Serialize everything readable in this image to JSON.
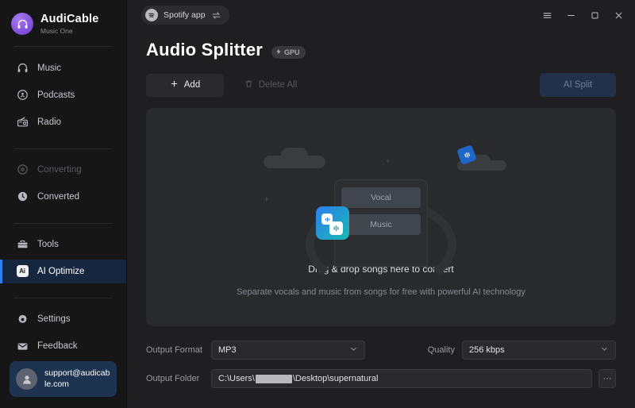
{
  "brand": {
    "name": "AudiCable",
    "subtitle": "Music One",
    "logo_icon": "headphones-icon"
  },
  "sidebar": {
    "groups": [
      {
        "items": [
          {
            "label": "Music",
            "icon": "headphones-icon",
            "state": "normal"
          },
          {
            "label": "Podcasts",
            "icon": "podcast-icon",
            "state": "normal"
          },
          {
            "label": "Radio",
            "icon": "radio-icon",
            "state": "normal"
          }
        ]
      },
      {
        "items": [
          {
            "label": "Converting",
            "icon": "sync-icon",
            "state": "disabled"
          },
          {
            "label": "Converted",
            "icon": "clock-icon",
            "state": "normal"
          }
        ]
      },
      {
        "items": [
          {
            "label": "Tools",
            "icon": "toolbox-icon",
            "state": "normal"
          },
          {
            "label": "AI Optimize",
            "icon": "ai-badge-icon",
            "state": "active"
          }
        ]
      },
      {
        "items": [
          {
            "label": "Settings",
            "icon": "gear-icon",
            "state": "normal"
          },
          {
            "label": "Feedback",
            "icon": "envelope-icon",
            "state": "normal"
          }
        ]
      }
    ],
    "user": {
      "email": "support@audicable.com",
      "avatar_icon": "user-avatar-icon"
    }
  },
  "titlebar": {
    "source_label": "Spotify app",
    "source_icon": "spotify-icon",
    "swap_icon": "swap-arrows-icon",
    "menu_icon": "hamburger-menu-icon",
    "minimize_icon": "minimize-icon",
    "maximize_icon": "maximize-icon",
    "close_icon": "close-icon"
  },
  "page": {
    "title": "Audio Splitter",
    "gpu_badge": "GPU",
    "gpu_icon": "lightning-bolt-icon"
  },
  "toolbar": {
    "add_label": "Add",
    "add_icon": "plus-icon",
    "delete_all_label": "Delete All",
    "delete_icon": "trash-icon",
    "split_label": "AI Split"
  },
  "dropzone": {
    "headline": "Drag & drop songs here to convert",
    "subtext": "Separate vocals and music from songs for free with powerful AI technology",
    "chip_vocal": "Vocal",
    "chip_music": "Music",
    "card_icon": "waveform-icon",
    "tilted_icon": "waveform-icon"
  },
  "form": {
    "output_format_label": "Output Format",
    "output_format_value": "MP3",
    "quality_label": "Quality",
    "quality_value": "256 kbps",
    "output_folder_label": "Output Folder",
    "output_folder_prefix": "C:\\Users\\",
    "output_folder_suffix": "\\Desktop\\supernatural",
    "browse_label": "···",
    "chevron_icon": "chevron-down-icon"
  },
  "colors": {
    "accent_blue": "#2f7ff0",
    "brand_purple": "#7c4dd6",
    "card_gradient_start": "#2d7ef0",
    "card_gradient_end": "#18b9b0",
    "sidebar_bg": "#161617",
    "main_bg": "#1f1f21",
    "panel_bg": "#292a2c"
  }
}
